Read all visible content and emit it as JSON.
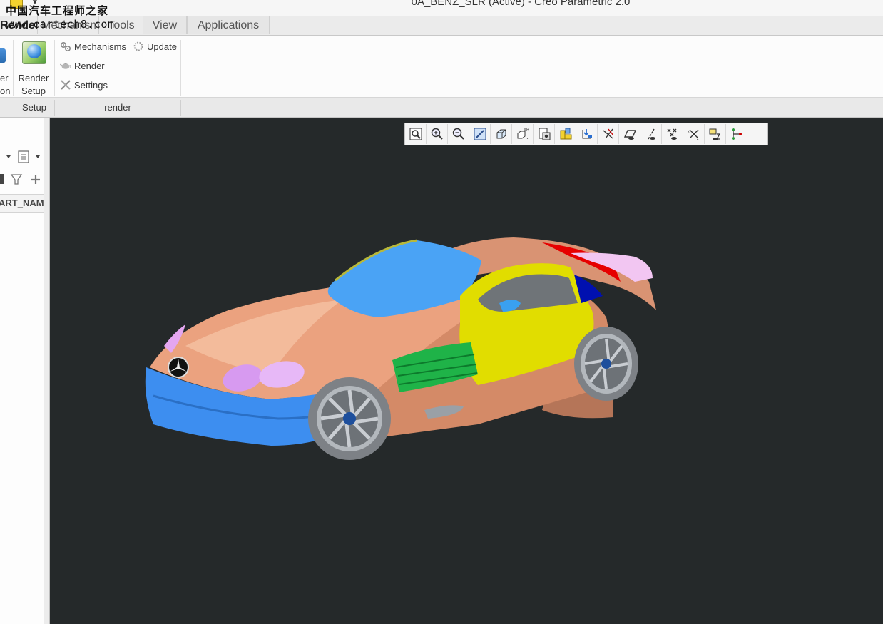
{
  "window": {
    "title": "0A_BENZ_SLR (Active) - Creo Parametric 2.0",
    "watermark_line1": "中国汽车工程师之家",
    "watermark_line2": "www.cartech8.com"
  },
  "tabs": [
    {
      "label": "Render"
    },
    {
      "label": "Mechanism"
    },
    {
      "label": "Tools"
    },
    {
      "label": "View"
    },
    {
      "label": "Applications"
    }
  ],
  "ribbon": {
    "cut_button": {
      "line1": "er",
      "line2": "on"
    },
    "render_setup": {
      "line1": "Render",
      "line2": "Setup"
    },
    "items": {
      "mechanisms": "Mechanisms",
      "update": "Update",
      "render": "Render",
      "settings": "Settings"
    },
    "groups": {
      "setup": "Setup",
      "render": "render"
    }
  },
  "model_tree": {
    "column_header": "PART_NAM",
    "column_header_visible": "ART_NAM"
  },
  "view_toolbar": {
    "buttons": [
      "refit-icon",
      "zoom-in-icon",
      "zoom-out-icon",
      "repaint-icon",
      "display-style-icon",
      "saved-views-icon",
      "view-manager-icon",
      "perspective-icon",
      "spin-center-icon",
      "datum-display-icon",
      "plane-display-icon",
      "axis-display-icon",
      "point-display-icon",
      "csys-display-icon",
      "annotation-display-icon",
      "appearance-icon"
    ]
  },
  "colors": {
    "graphics_bg": "#25292a",
    "body_tan": "#d98c6a",
    "hood_peach": "#eaa27f",
    "glass_blue": "#4aa3f5",
    "door_yellow": "#e4e000",
    "vent_green": "#22b04a",
    "light_violet": "#d79af0",
    "roof_red": "#e80000",
    "bumper_blue": "#3d8df0"
  }
}
